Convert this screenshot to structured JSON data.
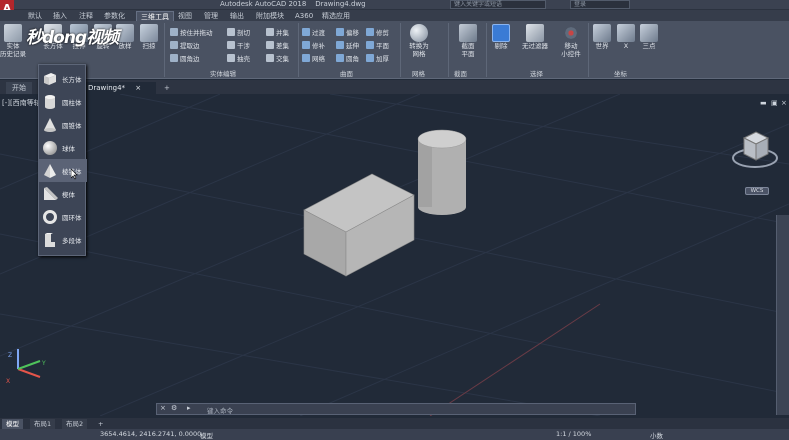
{
  "app": {
    "logo": "A",
    "title": "Autodesk AutoCAD 2018",
    "filename": "Drawing4.dwg",
    "search_placeholder": "键入关键字或短语",
    "login": "登录"
  },
  "ribbon_tabs": [
    {
      "label": "默认"
    },
    {
      "label": "插入"
    },
    {
      "label": "注释"
    },
    {
      "label": "参数化"
    },
    {
      "label": "三维工具"
    },
    {
      "label": "视图"
    },
    {
      "label": "管理"
    },
    {
      "label": "输出"
    },
    {
      "label": "附加模块"
    },
    {
      "label": "A360"
    },
    {
      "label": "精选应用"
    }
  ],
  "watermark": "秒dong视频",
  "ribbon": {
    "history": "实体\n历史记录",
    "box": "长方体",
    "extrude": "拉伸",
    "revolve": "旋转",
    "loft": "放样",
    "sweep": "扫掠",
    "solid_edit": {
      "presspull": "按住并拖动",
      "extract_edges": "提取边",
      "offset_edge": "偏移边",
      "fillet_edge": "圆角边",
      "slice": "剖切",
      "interfere": "干涉",
      "shell": "抽壳",
      "union": "并集",
      "subtract": "差集",
      "intersect": "交集",
      "panel_label": "实体编辑"
    },
    "surface": {
      "network": "网络",
      "blend": "过渡",
      "patch": "修补",
      "offset": "偏移",
      "fillet": "圆角",
      "extend": "延伸",
      "sculpt": "造型",
      "trim": "修剪",
      "flatten": "平面",
      "extrude": "加厚",
      "panel_label": "曲面"
    },
    "mesh": {
      "convert": "转换为\n网格",
      "panel_label": "网格"
    },
    "section": {
      "plane": "截面\n平面",
      "panel_label": "截面"
    },
    "selection": {
      "cull": "剔除",
      "no_filter": "无过滤器",
      "gizmo": "移动\n小控件",
      "panel_label": "选择"
    },
    "coords": {
      "world": "世界",
      "x": "X",
      "three_point": "三点",
      "panel_label": "坐标"
    }
  },
  "file_tabs": {
    "start": "开始",
    "drawing": "Drawing4*"
  },
  "viewport_label": "[-][西南等轴测]",
  "view_cube": {
    "wcs": "WCS"
  },
  "dropdown_items": [
    {
      "label": "长方体",
      "icon": "box-icon"
    },
    {
      "label": "圆柱体",
      "icon": "cylinder-icon"
    },
    {
      "label": "圆锥体",
      "icon": "cone-icon"
    },
    {
      "label": "球体",
      "icon": "sphere-icon"
    },
    {
      "label": "棱锥体",
      "icon": "pyramid-icon"
    },
    {
      "label": "楔体",
      "icon": "wedge-icon"
    },
    {
      "label": "圆环体",
      "icon": "torus-icon"
    },
    {
      "label": "多段体",
      "icon": "polysolid-icon"
    }
  ],
  "command_line": {
    "placeholder": "键入命令"
  },
  "model_tabs": [
    {
      "label": "模型"
    },
    {
      "label": "布局1"
    },
    {
      "label": "布局2"
    }
  ],
  "status": {
    "coordinates": "3654.4614, 2416.2741, 0.0000",
    "mode": "模型",
    "scale": "1:1 / 100%",
    "units": "小数"
  },
  "ucs": {
    "x": "X",
    "y": "Y",
    "z": "Z"
  },
  "colors": {
    "background": "#212a38",
    "ribbon": "#4a5262",
    "accent": "#3a7bd5"
  }
}
